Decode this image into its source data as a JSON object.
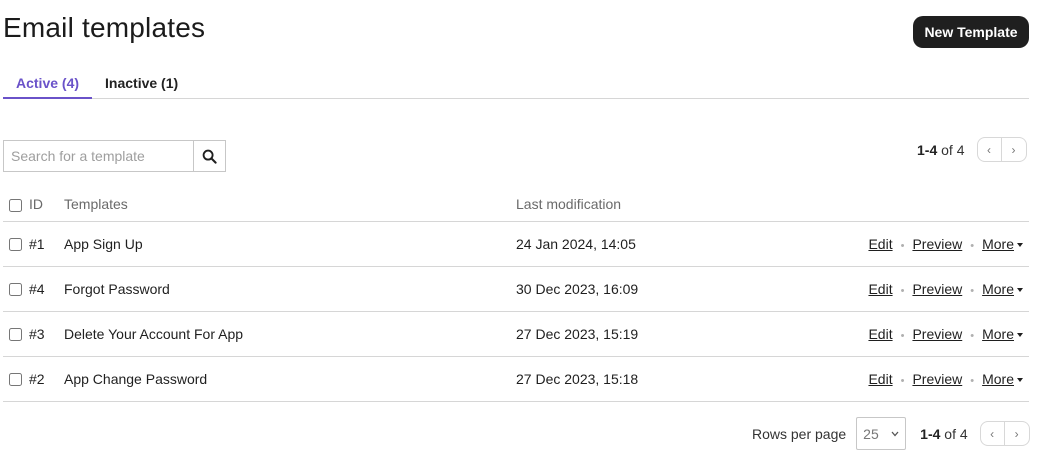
{
  "header": {
    "title": "Email templates",
    "new_button": "New Template"
  },
  "tabs": [
    {
      "label": "Active (4)",
      "active": true
    },
    {
      "label": "Inactive (1)",
      "active": false
    }
  ],
  "search": {
    "placeholder": "Search for a template",
    "value": ""
  },
  "pagination_top": {
    "range": "1-4",
    "of": "of",
    "total": "4"
  },
  "table": {
    "headers": {
      "id": "ID",
      "templates": "Templates",
      "last_modification": "Last modification"
    },
    "rows": [
      {
        "id": "#1",
        "name": "App Sign Up",
        "modified": "24 Jan 2024, 14:05"
      },
      {
        "id": "#4",
        "name": "Forgot Password",
        "modified": "30 Dec 2023, 16:09"
      },
      {
        "id": "#3",
        "name": "Delete Your Account For App",
        "modified": "27 Dec 2023, 15:19"
      },
      {
        "id": "#2",
        "name": "App Change Password",
        "modified": "27 Dec 2023, 15:18"
      }
    ],
    "actions": {
      "edit": "Edit",
      "preview": "Preview",
      "more": "More"
    }
  },
  "footer": {
    "rows_per_page_label": "Rows per page",
    "rows_per_page_value": "25",
    "range": "1-4",
    "of": "of",
    "total": "4"
  },
  "colors": {
    "accent": "#6a52c9",
    "primary_button": "#1f1f1f",
    "border": "#d6d6d6"
  },
  "icons": {
    "search": "search-icon",
    "prev": "chevron-left-icon",
    "next": "chevron-right-icon",
    "dropdown": "caret-down-icon"
  }
}
